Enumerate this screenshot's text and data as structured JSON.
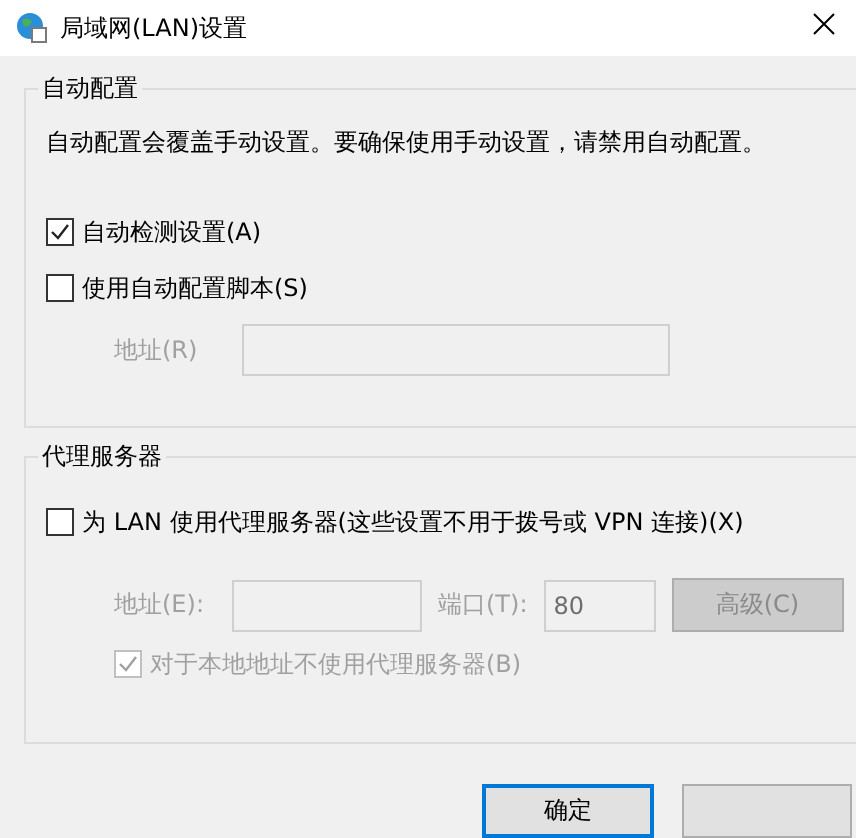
{
  "window": {
    "title": "局域网(LAN)设置"
  },
  "auto_config": {
    "title": "自动配置",
    "description": "自动配置会覆盖手动设置。要确保使用手动设置，请禁用自动配置。",
    "options": [
      {
        "label": "自动检测设置(A)",
        "checked": true,
        "disabled": false
      },
      {
        "label": "使用自动配置脚本(S)",
        "checked": false,
        "disabled": false
      }
    ],
    "address": {
      "label": "地址(R)",
      "disabled": true
    }
  },
  "proxy": {
    "title": "代理服务器",
    "use_proxy": {
      "label": "为 LAN 使用代理服务器(这些设置不用于拨号或 VPN 连接)(X)",
      "checked": false,
      "disabled": false
    },
    "address": {
      "label": "地址(E):",
      "disabled": true
    },
    "port": {
      "label": "端口(T):",
      "value": "80",
      "disabled": true
    },
    "advanced": {
      "label": "高级(C)",
      "disabled": true
    },
    "bypass_local": {
      "label": "对于本地地址不使用代理服务器(B)",
      "checked": true,
      "disabled": true
    }
  },
  "buttons": [
    {
      "label": "确定",
      "default": true
    },
    {
      "default": false
    }
  ]
}
